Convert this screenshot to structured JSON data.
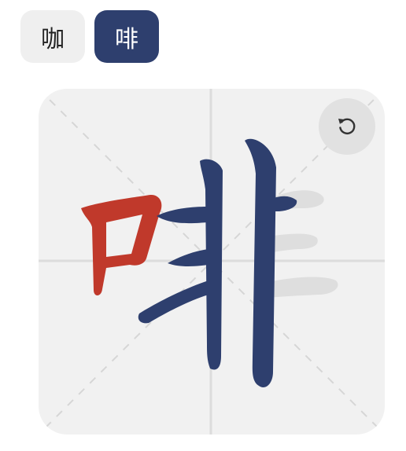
{
  "tabs": [
    {
      "label": "咖",
      "state": "inactive"
    },
    {
      "label": "啡",
      "state": "active"
    }
  ],
  "board": {
    "character": "啡",
    "reset_icon": "rotate-ccw-icon"
  },
  "colors": {
    "active_tab": "#2e3f6e",
    "completed_stroke": "#2e3f6e",
    "highlight_stroke": "#c0392b",
    "ghost_stroke": "#dedede",
    "grid_line": "#dcdcdc"
  }
}
